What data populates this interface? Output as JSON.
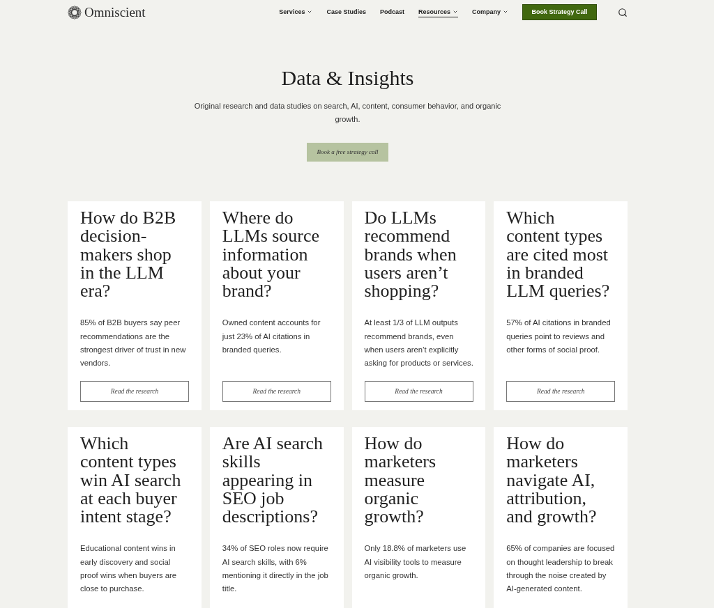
{
  "header": {
    "logo_text": "Omniscient",
    "nav": [
      {
        "label": "Services",
        "dropdown": true,
        "selected": false
      },
      {
        "label": "Case Studies",
        "dropdown": false,
        "selected": false
      },
      {
        "label": "Podcast",
        "dropdown": false,
        "selected": false
      },
      {
        "label": "Resources",
        "dropdown": true,
        "selected": true
      },
      {
        "label": "Company",
        "dropdown": true,
        "selected": false
      }
    ],
    "cta": "Book Strategy Call"
  },
  "hero": {
    "title": "Data & Insights",
    "subtitle": "Original research and data studies on search, AI, content, consumer behavior, and organic growth.",
    "button": "Book a free strategy call"
  },
  "cards": [
    {
      "title": "How do B2B decision-makers shop in the LLM era?",
      "summary": "85% of B2B buyers say peer recommendations are the strongest driver of trust in new vendors.",
      "button": "Read the research"
    },
    {
      "title": "Where do LLMs source information about your brand?",
      "summary": "Owned content accounts for just 23% of AI citations in branded queries.",
      "button": "Read the research"
    },
    {
      "title": "Do LLMs recommend brands when users aren’t shopping?",
      "summary": "At least 1/3 of LLM outputs recommend brands, even when users aren’t explicitly asking for products or services.",
      "button": "Read the research"
    },
    {
      "title": "Which content types are cited most in branded LLM queries?",
      "summary": "57% of AI citations in branded queries point to reviews and other forms of social proof.",
      "button": "Read the research"
    },
    {
      "title": "Which content types win AI search at each buyer intent stage?",
      "summary": "Educational content wins in early discovery and social proof wins when buyers are close to purchase."
    },
    {
      "title": "Are AI search skills appearing in SEO job descriptions?",
      "summary": "34% of SEO roles now require AI search skills, with 6% mentioning it directly in the job title."
    },
    {
      "title": "How do marketers measure organic growth?",
      "summary": "Only 18.8% of marketers use AI visibility tools to measure organic growth."
    },
    {
      "title": "How do marketers navigate AI, attribution, and growth?",
      "summary": "65% of companies are focused on thought leadership to break through the noise created by AI-generated content."
    }
  ]
}
